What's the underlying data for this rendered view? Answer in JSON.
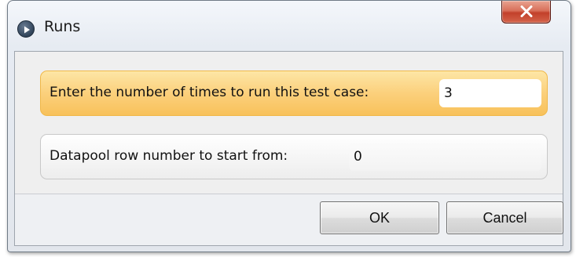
{
  "window": {
    "title": "Runs"
  },
  "fields": {
    "iterations": {
      "label": "Enter the number of times to run this test case:",
      "value": "3"
    },
    "datapool_row": {
      "label": "Datapool row number to start from:",
      "value": "0"
    }
  },
  "buttons": {
    "ok": "OK",
    "cancel": "Cancel"
  },
  "icons": {
    "app": "play-circle-icon",
    "close": "close-icon"
  },
  "colors": {
    "active_field": "#f8c15a",
    "close_button": "#c2402a"
  }
}
